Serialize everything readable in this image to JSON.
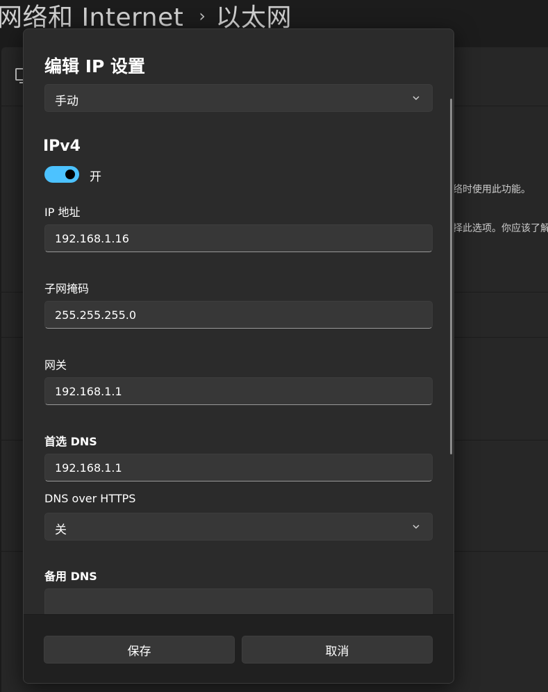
{
  "background": {
    "breadcrumb_parent": "网络和 Internet",
    "breadcrumb_separator": "›",
    "breadcrumb_current": "以太网",
    "snippet_1": "络时使用此功能。",
    "snippet_2": "择此选项。你应该了解"
  },
  "dialog": {
    "title": "编辑 IP 设置",
    "mode_value": "手动",
    "ipv4_title": "IPv4",
    "ipv4_toggle_label": "开",
    "ipv4_enabled": true,
    "ip_label": "IP 地址",
    "ip_value": "192.168.1.16",
    "subnet_label": "子网掩码",
    "subnet_value": "255.255.255.0",
    "gateway_label": "网关",
    "gateway_value": "192.168.1.1",
    "preferred_dns_label": "首选 DNS",
    "preferred_dns_value": "192.168.1.1",
    "doh_label": "DNS over HTTPS",
    "doh_value": "关",
    "alternate_dns_label": "备用 DNS",
    "alternate_dns_value": "",
    "save_label": "保存",
    "cancel_label": "取消"
  },
  "colors": {
    "accent": "#4cc2ff",
    "dialog_bg": "#2b2b2b",
    "field_bg": "#373737",
    "footer_bg": "#202020"
  }
}
